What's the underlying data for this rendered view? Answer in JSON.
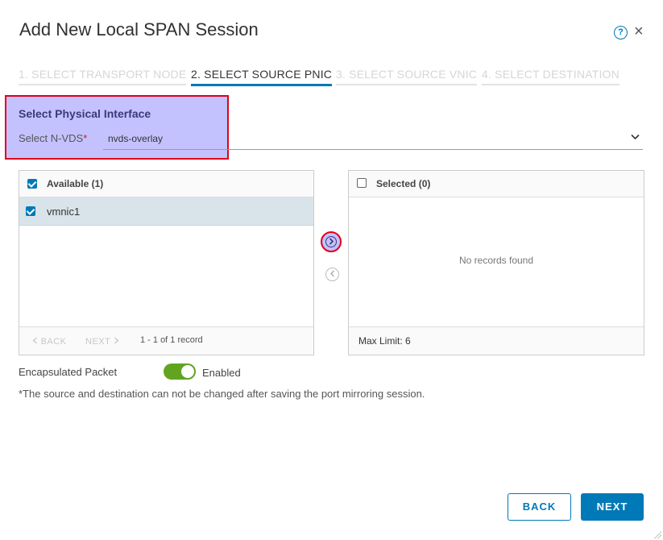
{
  "dialog": {
    "title": "Add New Local SPAN Session",
    "help_icon_glyph": "?",
    "close_icon_glyph": "×"
  },
  "steps": [
    {
      "label": "1. SELECT TRANSPORT NODE",
      "state": "inactive"
    },
    {
      "label": "2. SELECT SOURCE PNIC",
      "state": "active"
    },
    {
      "label": "3. SELECT SOURCE VNIC",
      "state": "inactive"
    },
    {
      "label": "4. SELECT DESTINATION",
      "state": "inactive"
    }
  ],
  "physical_interface": {
    "section_title": "Select Physical Interface",
    "nvds_label": "Select N-VDS",
    "required_mark": "*",
    "nvds_value": "nvds-overlay"
  },
  "available": {
    "header": "Available (1)",
    "items": [
      {
        "label": "vmnic1",
        "checked": true
      }
    ],
    "pager_back": "BACK",
    "pager_next": "NEXT",
    "pager_info": "1 - 1 of 1 record"
  },
  "selected": {
    "header": "Selected (0)",
    "empty_text": "No records found",
    "max_limit": "Max Limit: 6"
  },
  "encapsulated": {
    "label": "Encapsulated Packet",
    "state_label": "Enabled",
    "enabled": true
  },
  "note": "*The source and destination can not be changed after saving the port mirroring session.",
  "buttons": {
    "back": "BACK",
    "next": "NEXT"
  },
  "colors": {
    "accent": "#0079b8",
    "highlight": "#c3c2ff",
    "highlight_border": "#e0001b",
    "toggle_on": "#62a420"
  }
}
